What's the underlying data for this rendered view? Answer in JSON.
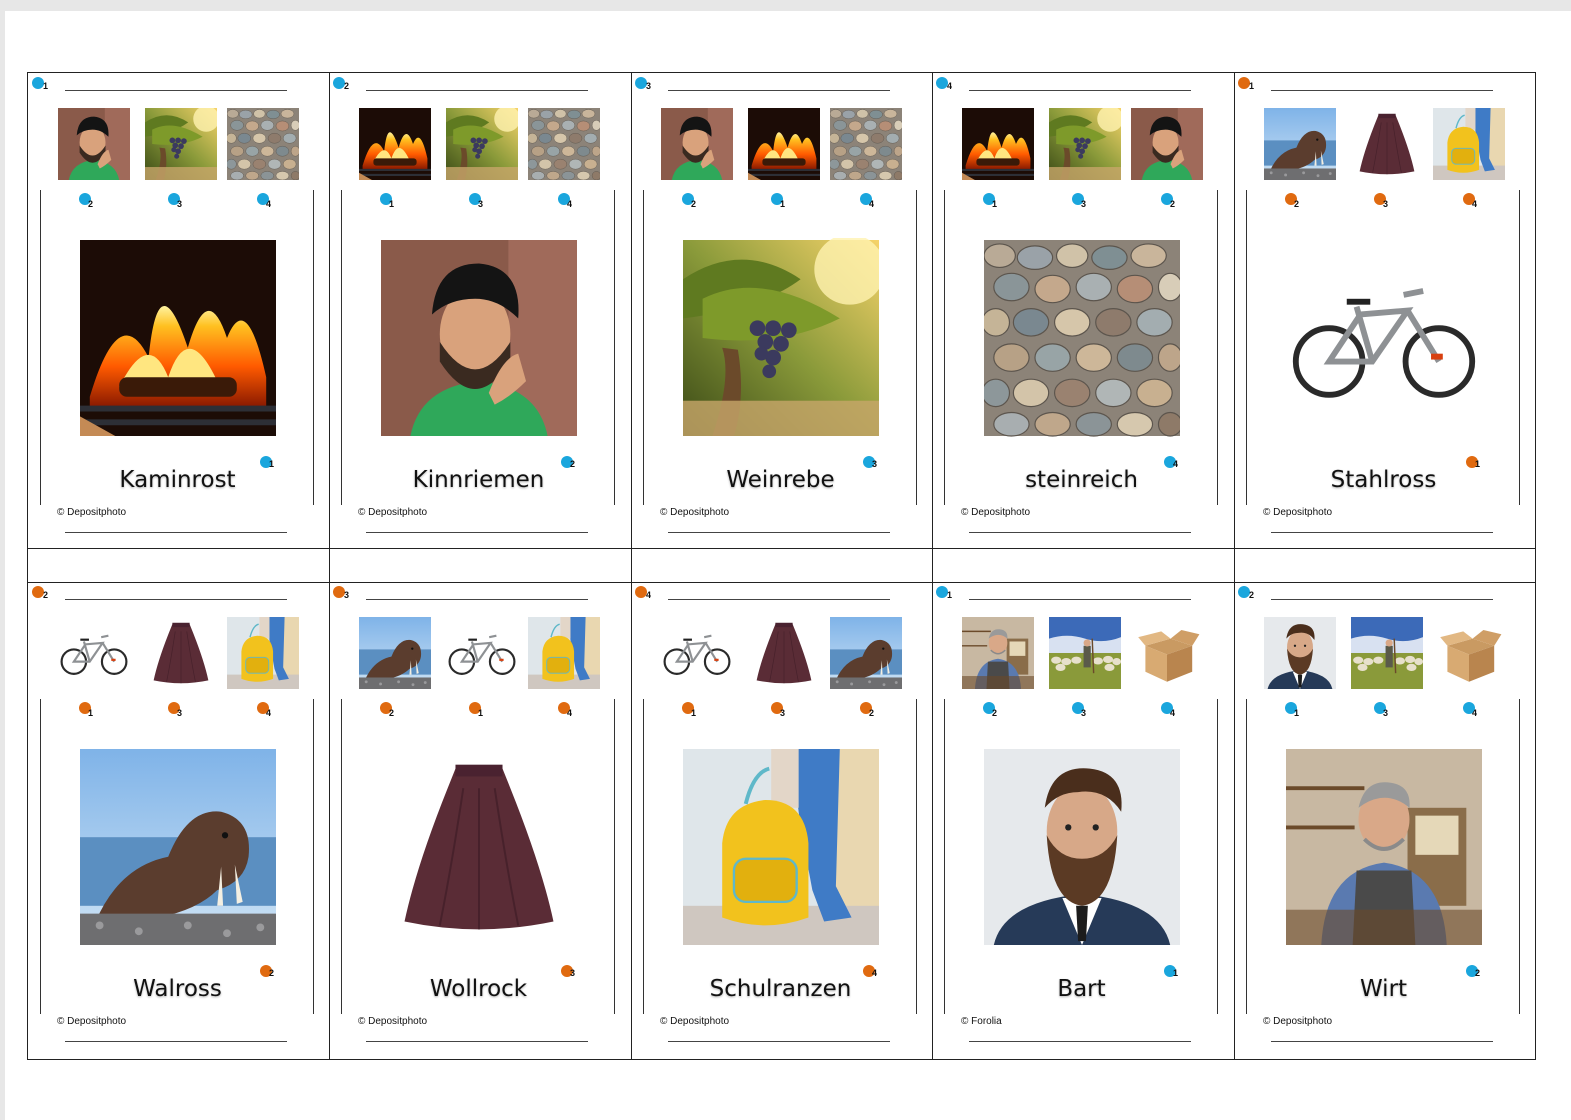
{
  "colors": {
    "blue_dot": "#1aa6dd",
    "orange_dot": "#e06a10"
  },
  "cards": [
    {
      "word": "Kaminrost",
      "credit": "© Depositphoto",
      "color": "blue",
      "corner_label": "1",
      "thumbs": [
        "helmet-man-image",
        "grapevine-image",
        "pebbles-image"
      ],
      "thumb_labels": [
        "2",
        "3",
        "4"
      ],
      "main_image": "fireplace-image",
      "answer_label": "1"
    },
    {
      "word": "Kinnriemen",
      "credit": "© Depositphoto",
      "color": "blue",
      "corner_label": "2",
      "thumbs": [
        "fireplace-image",
        "grapevine-image",
        "pebbles-image"
      ],
      "thumb_labels": [
        "1",
        "3",
        "4"
      ],
      "main_image": "helmet-man-image",
      "answer_label": "2"
    },
    {
      "word": "Weinrebe",
      "credit": "© Depositphoto",
      "color": "blue",
      "corner_label": "3",
      "thumbs": [
        "helmet-man-image",
        "fireplace-image",
        "pebbles-image"
      ],
      "thumb_labels": [
        "2",
        "1",
        "4"
      ],
      "main_image": "grapevine-image",
      "answer_label": "3"
    },
    {
      "word": "steinreich",
      "credit": "© Depositphoto",
      "color": "blue",
      "corner_label": "4",
      "thumbs": [
        "fireplace-image",
        "grapevine-image",
        "helmet-man-image"
      ],
      "thumb_labels": [
        "1",
        "3",
        "2"
      ],
      "main_image": "pebbles-image",
      "answer_label": "4"
    },
    {
      "word": "Stahlross",
      "credit": "© Depositphoto",
      "color": "orange",
      "corner_label": "1",
      "thumbs": [
        "walrus-image",
        "skirt-image",
        "backpack-image"
      ],
      "thumb_labels": [
        "2",
        "3",
        "4"
      ],
      "main_image": "bicycle-image",
      "answer_label": "1"
    },
    {
      "word": "Walross",
      "credit": "© Depositphoto",
      "color": "orange",
      "corner_label": "2",
      "thumbs": [
        "bicycle-image",
        "skirt-image",
        "backpack-image"
      ],
      "thumb_labels": [
        "1",
        "3",
        "4"
      ],
      "main_image": "walrus-image",
      "answer_label": "2"
    },
    {
      "word": "Wollrock",
      "credit": "© Depositphoto",
      "color": "orange",
      "corner_label": "3",
      "thumbs": [
        "walrus-image",
        "bicycle-image",
        "backpack-image"
      ],
      "thumb_labels": [
        "2",
        "1",
        "4"
      ],
      "main_image": "skirt-image",
      "answer_label": "3"
    },
    {
      "word": "Schulranzen",
      "credit": "© Depositphoto",
      "color": "orange",
      "corner_label": "4",
      "thumbs": [
        "bicycle-image",
        "skirt-image",
        "walrus-image"
      ],
      "thumb_labels": [
        "1",
        "3",
        "2"
      ],
      "main_image": "backpack-image",
      "answer_label": "4"
    },
    {
      "word": "Bart",
      "credit": "© Forolia",
      "color": "blue",
      "corner_label": "1",
      "thumbs": [
        "innkeeper-image",
        "shepherd-image",
        "box-image"
      ],
      "thumb_labels": [
        "2",
        "3",
        "4"
      ],
      "main_image": "bearded-man-image",
      "answer_label": "1"
    },
    {
      "word": "Wirt",
      "credit": "© Depositphoto",
      "color": "blue",
      "corner_label": "2",
      "thumbs": [
        "bearded-man-image",
        "shepherd-image",
        "box-image"
      ],
      "thumb_labels": [
        "1",
        "3",
        "4"
      ],
      "main_image": "innkeeper-image",
      "answer_label": "2"
    }
  ]
}
